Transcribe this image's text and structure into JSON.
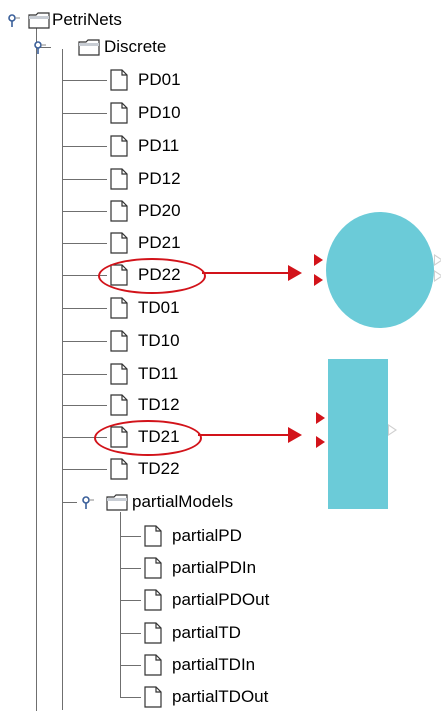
{
  "tree": {
    "root": {
      "label": "PetriNets"
    },
    "discrete": {
      "label": "Discrete"
    },
    "discrete_items": [
      "PD01",
      "PD10",
      "PD11",
      "PD12",
      "PD20",
      "PD21",
      "PD22",
      "TD01",
      "TD10",
      "TD11",
      "TD12",
      "TD21",
      "TD22"
    ],
    "partial": {
      "label": "partialModels"
    },
    "partial_items": [
      "partialPD",
      "partialPDIn",
      "partialPDOut",
      "partialTD",
      "partialTDIn",
      "partialTDOut"
    ]
  },
  "highlighted_items": [
    "PD22",
    "TD21"
  ],
  "icons": {
    "toggle": "expand-collapse-key-icon",
    "folder": "folder-icon",
    "file": "file-icon",
    "arrow": "red-arrow",
    "place": "cyan-circle-shape",
    "transition": "cyan-rectangle-shape"
  },
  "colors": {
    "highlight": "#d2131a",
    "shape_fill": "#6bcbd8",
    "tree_line": "#6f6f6f"
  }
}
